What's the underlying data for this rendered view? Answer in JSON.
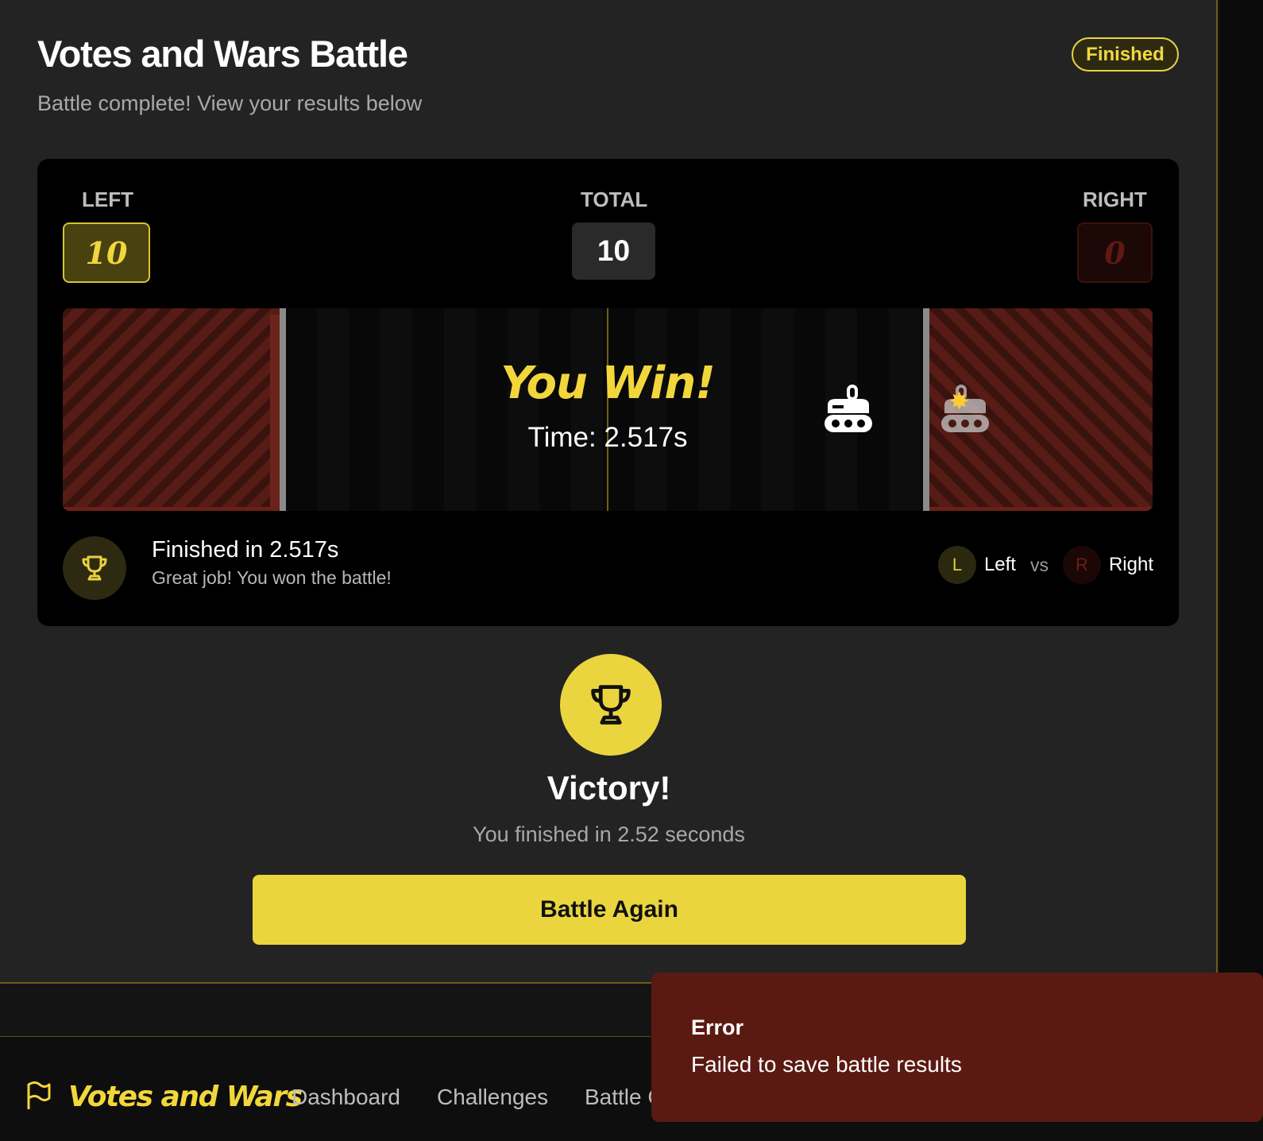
{
  "header": {
    "title": "Votes and Wars Battle",
    "subtitle": "Battle complete! View your results below",
    "status_badge": "Finished"
  },
  "scoreboard": {
    "left_label": "LEFT",
    "total_label": "TOTAL",
    "right_label": "RIGHT",
    "left_score": "10",
    "total_score": "10",
    "right_score": "0"
  },
  "arena": {
    "result_text": "You Win!",
    "time_text": "Time: 2.517s",
    "left_tank_icon": "tank-icon",
    "right_tank_icon": "tank-icon",
    "explosion_icon": "explosion-icon"
  },
  "summary": {
    "finished_text": "Finished in 2.517s",
    "message": "Great job! You won the battle!",
    "left_avatar": "L",
    "left_name": "Left",
    "vs": "vs",
    "right_avatar": "R",
    "right_name": "Right"
  },
  "victory": {
    "title": "Victory!",
    "subtitle": "You finished in 2.52 seconds",
    "button_label": "Battle Again"
  },
  "nav": {
    "brand": "Votes and Wars",
    "links": [
      "Dashboard",
      "Challenges",
      "Battle C"
    ]
  },
  "toast": {
    "title": "Error",
    "message": "Failed to save battle results"
  },
  "colors": {
    "accent": "#ead53f",
    "danger": "#5a1a12",
    "panel": "#000000",
    "card": "#232323"
  }
}
